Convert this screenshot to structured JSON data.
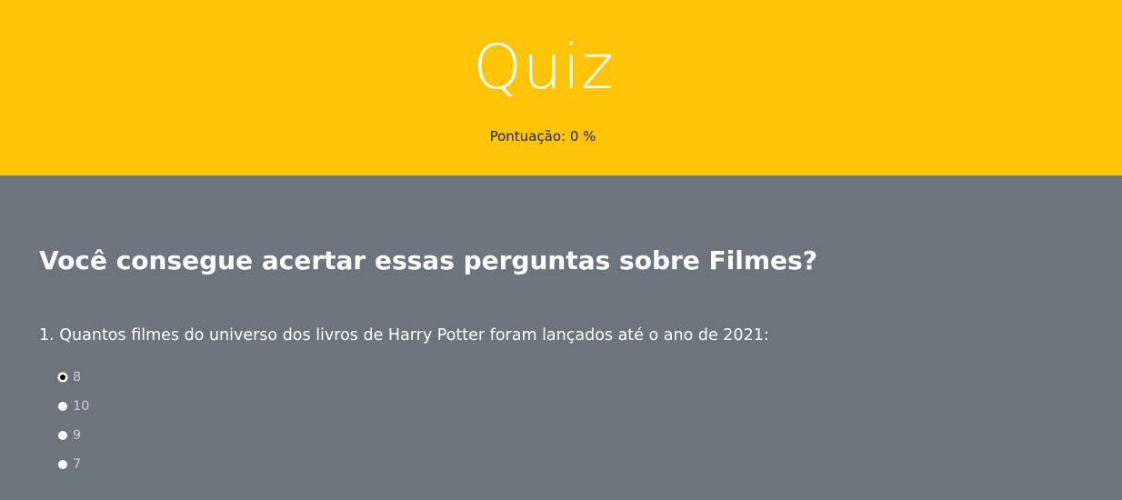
{
  "header": {
    "title": "Quiz",
    "score_text": "Pontuação: 0 %"
  },
  "main": {
    "headline": "Você consegue acertar essas perguntas sobre Filmes?",
    "questions": [
      {
        "text": "1. Quantos filmes do universo dos livros de Harry Potter foram lançados até o ano de 2021:",
        "options": [
          {
            "label": "8",
            "selected": true
          },
          {
            "label": "10",
            "selected": false
          },
          {
            "label": "9",
            "selected": false
          },
          {
            "label": "7",
            "selected": false
          }
        ]
      }
    ]
  },
  "colors": {
    "header_bg": "#ffc408",
    "body_bg": "#6c757d",
    "text_light": "#ffffff",
    "option_text": "#c9ced3"
  }
}
